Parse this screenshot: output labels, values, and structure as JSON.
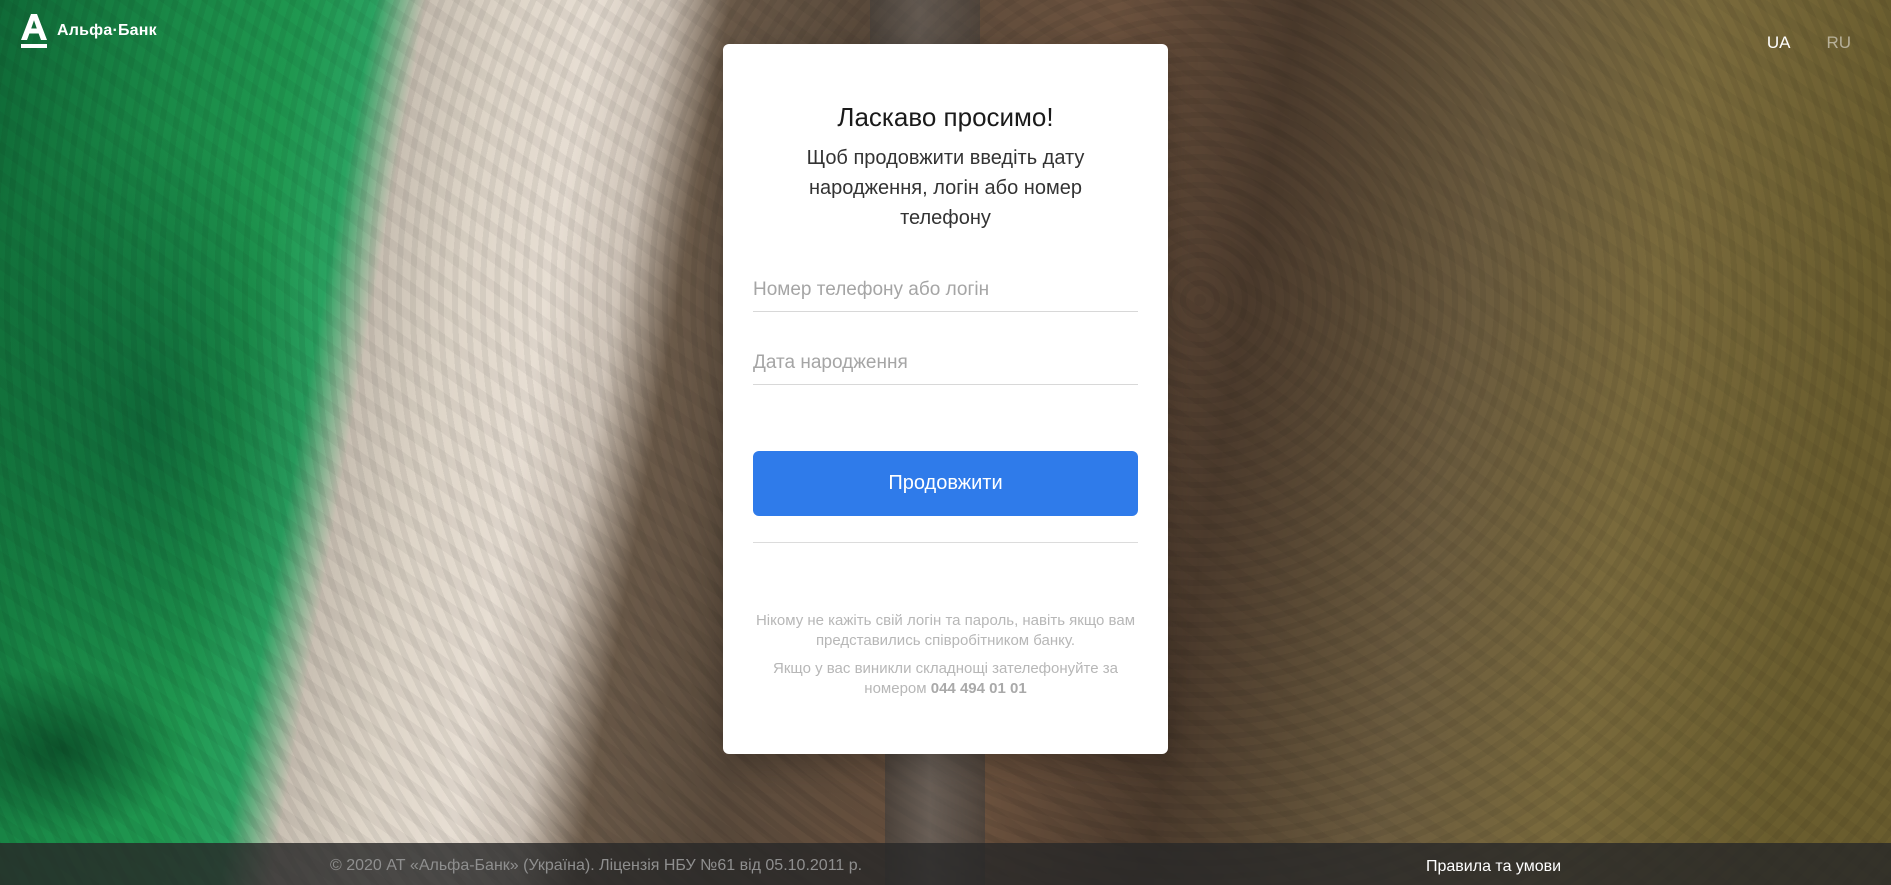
{
  "header": {
    "logo_text": "Альфа·Банк",
    "languages": [
      {
        "label": "UA",
        "active": true
      },
      {
        "label": "RU",
        "active": false
      }
    ]
  },
  "card": {
    "title": "Ласкаво просимо!",
    "subtitle": "Щоб продовжити введіть дату народження, логін або номер телефону",
    "login_field": {
      "placeholder": "Номер телефону або логін",
      "value": ""
    },
    "birthdate_field": {
      "placeholder": "Дата народження",
      "value": ""
    },
    "continue_button": "Продовжити",
    "notice_1": "Нікому не кажіть свій логін та пароль, навіть якщо вам представились співробітником банку.",
    "notice_2_prefix": "Якщо у вас виникли складнощі зателефонуйте за номером",
    "notice_phone": "044 494 01 01"
  },
  "footer": {
    "copyright": "© 2020 АТ «Альфа-Банк» (Україна). Ліцензія НБУ №61 від 05.10.2011 р.",
    "terms_link": "Правила та умови"
  },
  "colors": {
    "accent": "#2f7bea",
    "card_bg": "#ffffff",
    "footer_bg": "#282828"
  },
  "icons": {
    "logo": "alfa-bank-logo-icon"
  }
}
